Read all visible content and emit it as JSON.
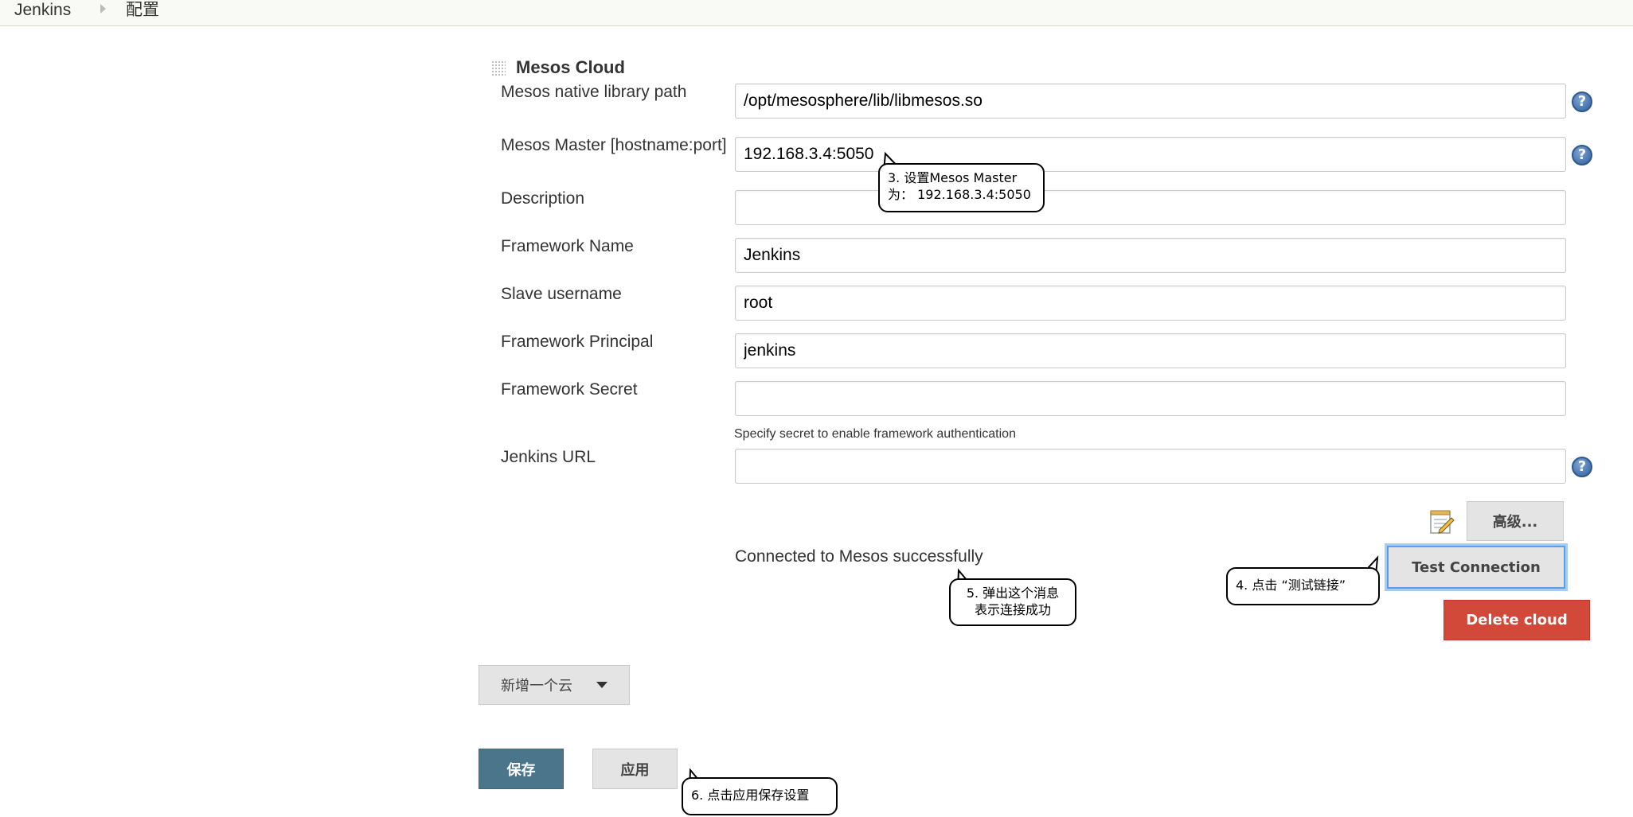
{
  "breadcrumb": {
    "home": "Jenkins",
    "current": "配置"
  },
  "section": {
    "title": "Mesos Cloud"
  },
  "fields": [
    {
      "label": "Mesos native library path",
      "value": "/opt/mesosphere/lib/libmesos.so"
    },
    {
      "label": "Mesos Master [hostname:port]",
      "value": "192.168.3.4:5050"
    },
    {
      "label": "Description",
      "value": ""
    },
    {
      "label": "Framework Name",
      "value": "Jenkins"
    },
    {
      "label": "Slave username",
      "value": "root"
    },
    {
      "label": "Framework Principal",
      "value": "jenkins"
    },
    {
      "label": "Framework Secret",
      "value": ""
    },
    {
      "label": "Jenkins URL",
      "value": ""
    }
  ],
  "secret_hint": "Specify secret to enable framework authentication",
  "help_glyph": "?",
  "buttons": {
    "advanced": "高级...",
    "test_connection": "Test Connection",
    "delete_cloud": "Delete cloud",
    "add_cloud": "新增一个云",
    "save": "保存",
    "apply": "应用"
  },
  "status": {
    "connected": "Connected to Mesos successfully"
  },
  "callouts": {
    "c3_line1": "3. 设置Mesos Master",
    "c3_line2": "为： 192.168.3.4:5050",
    "c4": "4. 点击 “测试链接”",
    "c5_line1": "5. 弹出这个消息",
    "c5_line2": "表示连接成功",
    "c6": "6. 点击应用保存设置"
  },
  "icons": {
    "help": "help-icon",
    "drag": "drag-handle-icon",
    "notepad": "notepad-icon",
    "dropdown": "chevron-down-icon",
    "breadcrumb_sep": "chevron-right-icon"
  },
  "colors": {
    "help": "#2f5f9e",
    "test_border": "#5b9ee8",
    "delete": "#d24939",
    "save": "#4b758b",
    "topbar": "#f9f9f5"
  }
}
